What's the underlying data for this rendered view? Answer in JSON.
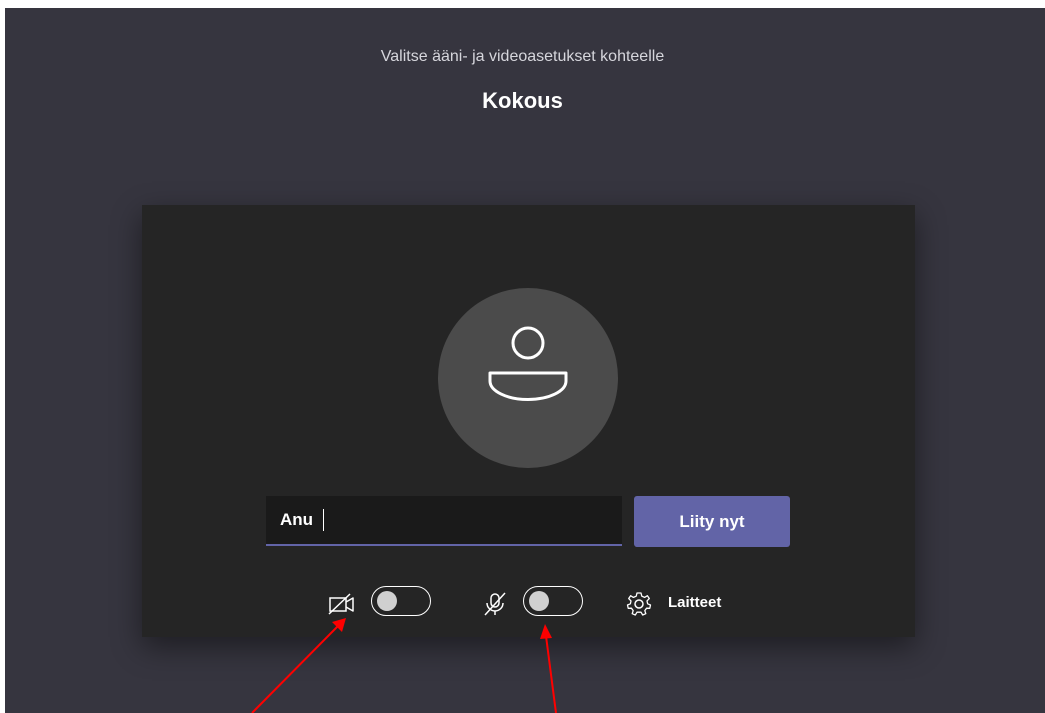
{
  "header": {
    "subtitle": "Valitse ääni- ja videoasetukset kohteelle",
    "meeting_title": "Kokous"
  },
  "prejoin": {
    "name_value": "Anu",
    "join_label": "Liity nyt",
    "camera": {
      "icon": "camera-off-icon",
      "on": false
    },
    "microphone": {
      "icon": "mic-off-icon",
      "on": false
    },
    "devices": {
      "icon": "gear-icon",
      "label": "Laitteet"
    }
  },
  "annotations": {
    "arrow_color": "#ff0000",
    "count": 2
  },
  "colors": {
    "background": "#36353f",
    "panel": "#252525",
    "accent": "#6264a7",
    "avatar": "#4b4b4b"
  }
}
